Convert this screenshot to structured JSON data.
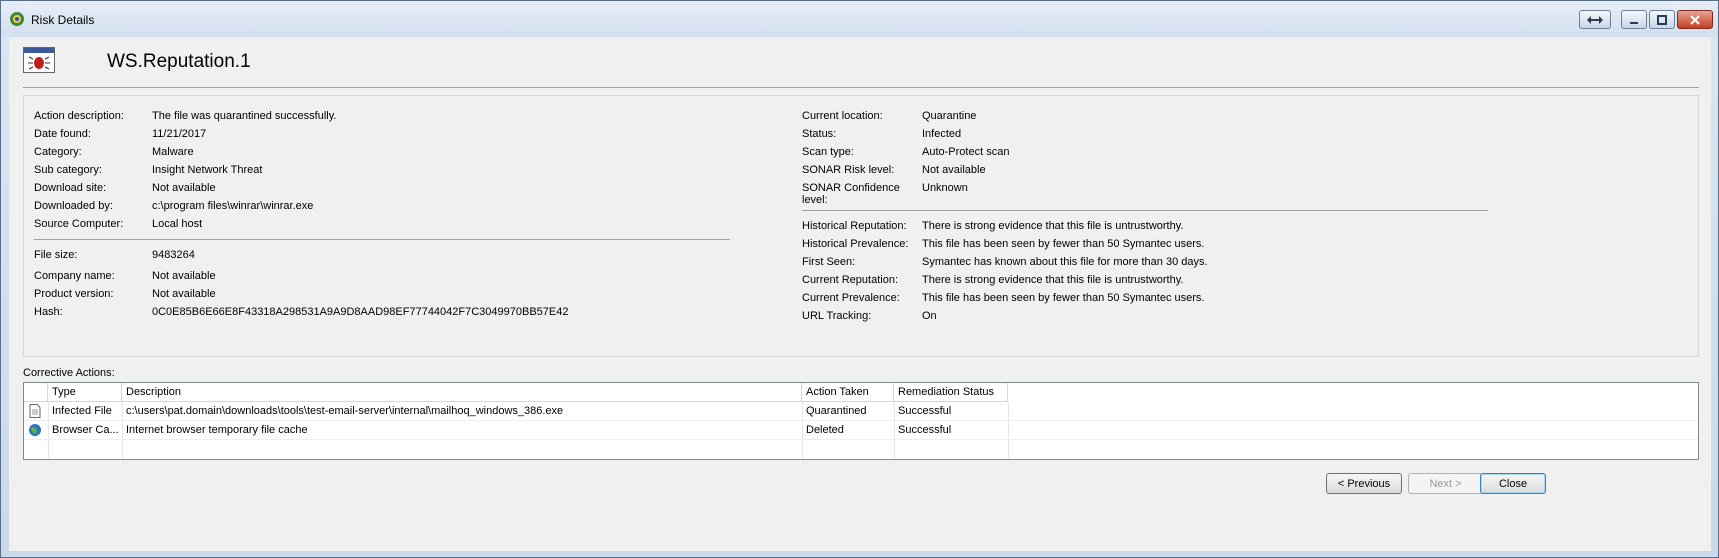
{
  "window": {
    "title": "Risk Details"
  },
  "header": {
    "title": "WS.Reputation.1"
  },
  "left_fields": [
    {
      "label": "Action description:",
      "value": "The file was quarantined successfully."
    },
    {
      "label": "Date found:",
      "value": "11/21/2017"
    },
    {
      "label": "Category:",
      "value": "Malware"
    },
    {
      "label": "Sub category:",
      "value": "Insight Network Threat"
    },
    {
      "label": "Download site:",
      "value": "Not available"
    },
    {
      "label": "Downloaded by:",
      "value": "c:\\program files\\winrar\\winrar.exe"
    },
    {
      "label": "Source Computer:",
      "value": "Local host"
    }
  ],
  "file_fields": [
    {
      "label": "File size:",
      "value": "9483264"
    },
    {
      "label": "Company name:",
      "value": "Not available"
    },
    {
      "label": "Product version:",
      "value": "Not available"
    },
    {
      "label": "Hash:",
      "value": "0C0E85B6E66E8F43318A298531A9A9D8AAD98EF77744042F7C3049970BB57E42"
    }
  ],
  "right_fields": [
    {
      "label": "Current location:",
      "value": "Quarantine"
    },
    {
      "label": "Status:",
      "value": "Infected"
    },
    {
      "label": "Scan type:",
      "value": "Auto-Protect scan"
    },
    {
      "label": "SONAR Risk level:",
      "value": "Not available"
    },
    {
      "label": "SONAR Confidence",
      "label2": "level:",
      "value": "Unknown"
    }
  ],
  "reputation_fields": [
    {
      "label": "Historical Reputation:",
      "value": "There is strong evidence that this file is untrustworthy."
    },
    {
      "label": "Historical Prevalence:",
      "value": "This file has been seen by fewer than 50 Symantec users."
    },
    {
      "label": "First Seen:",
      "value": "Symantec has known about this file for more than 30 days."
    },
    {
      "label": "Current Reputation:",
      "value": "There is strong evidence that this file is untrustworthy."
    },
    {
      "label": "Current Prevalence:",
      "value": "This file has been seen by fewer than 50 Symantec users."
    },
    {
      "label": "URL Tracking:",
      "value": "On"
    }
  ],
  "corrective": {
    "label": "Corrective Actions:",
    "columns": [
      "Type",
      "Description",
      "Action Taken",
      "Remediation Status"
    ],
    "rows": [
      {
        "icon": "file-icon",
        "type": "Infected File",
        "description": "c:\\users\\pat.domain\\downloads\\tools\\test-email-server\\internal\\mailhoq_windows_386.exe",
        "action": "Quarantined",
        "status": "Successful"
      },
      {
        "icon": "globe-icon",
        "type": "Browser Ca...",
        "description": "Internet browser temporary file cache",
        "action": "Deleted",
        "status": "Successful"
      }
    ]
  },
  "buttons": {
    "previous": "< Previous",
    "next": "Next >",
    "close": "Close"
  }
}
